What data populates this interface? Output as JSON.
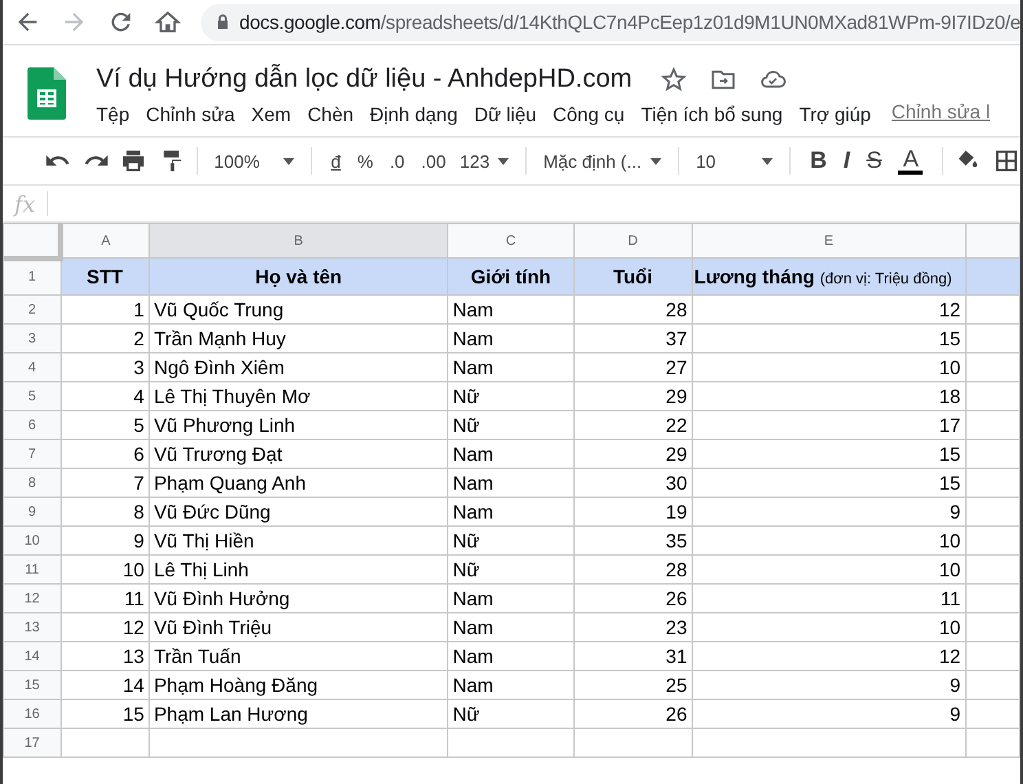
{
  "browser": {
    "url": "docs.google.com/spreadsheets/d/14KthQLC7n4PcEep1z01d9M1UN0MXad81WPm-9I7IDz0/e"
  },
  "document": {
    "title": "Ví dụ Hướng dẫn lọc dữ liệu - AnhdepHD.com",
    "menu": [
      "Tệp",
      "Chỉnh sửa",
      "Xem",
      "Chèn",
      "Định dạng",
      "Dữ liệu",
      "Công cụ",
      "Tiện ích bổ sung",
      "Trợ giúp"
    ],
    "edit_link": "Chỉnh sửa l"
  },
  "toolbar": {
    "zoom": "100%",
    "currency": "đ",
    "percent": "%",
    "decrease_decimals": ".0",
    "increase_decimals": ".00",
    "number_format": "123",
    "font": "Mặc định (...",
    "font_size": "10",
    "bold": "B",
    "italic": "I",
    "strikethrough": "S",
    "text_color": "A"
  },
  "formula_bar": {
    "label": "fx"
  },
  "sheet": {
    "columns": [
      {
        "label": "A",
        "kind": "number",
        "selected": false
      },
      {
        "label": "B",
        "kind": "text",
        "selected": true
      },
      {
        "label": "C",
        "kind": "text",
        "selected": false
      },
      {
        "label": "D",
        "kind": "number",
        "selected": false
      },
      {
        "label": "E",
        "kind": "number",
        "selected": false
      }
    ],
    "header_row": {
      "number": "1",
      "cells": [
        {
          "text": "STT"
        },
        {
          "text": "Họ và tên"
        },
        {
          "text": "Giới tính"
        },
        {
          "text": "Tuổi"
        },
        {
          "text": "Lương tháng",
          "note": "(đơn vị: Triệu đồng)"
        }
      ]
    },
    "rows": [
      {
        "number": "2",
        "cells": [
          "1",
          "Vũ Quốc Trung",
          "Nam",
          "28",
          "12"
        ]
      },
      {
        "number": "3",
        "cells": [
          "2",
          "Trần Mạnh Huy",
          "Nam",
          "37",
          "15"
        ]
      },
      {
        "number": "4",
        "cells": [
          "3",
          "Ngô Đình Xiêm",
          "Nam",
          "27",
          "10"
        ]
      },
      {
        "number": "5",
        "cells": [
          "4",
          "Lê Thị Thuyên Mơ",
          "Nữ",
          "29",
          "18"
        ]
      },
      {
        "number": "6",
        "cells": [
          "5",
          "Vũ Phương Linh",
          "Nữ",
          "22",
          "17"
        ]
      },
      {
        "number": "7",
        "cells": [
          "6",
          "Vũ Trương Đạt",
          "Nam",
          "29",
          "15"
        ]
      },
      {
        "number": "8",
        "cells": [
          "7",
          "Phạm Quang Anh",
          "Nam",
          "30",
          "15"
        ]
      },
      {
        "number": "9",
        "cells": [
          "8",
          "Vũ Đức Dũng",
          "Nam",
          "19",
          "9"
        ]
      },
      {
        "number": "10",
        "cells": [
          "9",
          "Vũ Thị Hiền",
          "Nữ",
          "35",
          "10"
        ]
      },
      {
        "number": "11",
        "cells": [
          "10",
          "Lê Thị Linh",
          "Nữ",
          "28",
          "10"
        ]
      },
      {
        "number": "12",
        "cells": [
          "11",
          "Vũ Đình Hưởng",
          "Nam",
          "26",
          "11"
        ]
      },
      {
        "number": "13",
        "cells": [
          "12",
          "Vũ Đình Triệu",
          "Nam",
          "23",
          "10"
        ]
      },
      {
        "number": "14",
        "cells": [
          "13",
          "Trần Tuấn",
          "Nam",
          "31",
          "12"
        ]
      },
      {
        "number": "15",
        "cells": [
          "14",
          "Phạm Hoàng Đăng",
          "Nam",
          "25",
          "9"
        ]
      },
      {
        "number": "16",
        "cells": [
          "15",
          "Phạm Lan Hương",
          "Nữ",
          "26",
          "9"
        ]
      },
      {
        "number": "17",
        "cells": []
      }
    ]
  }
}
